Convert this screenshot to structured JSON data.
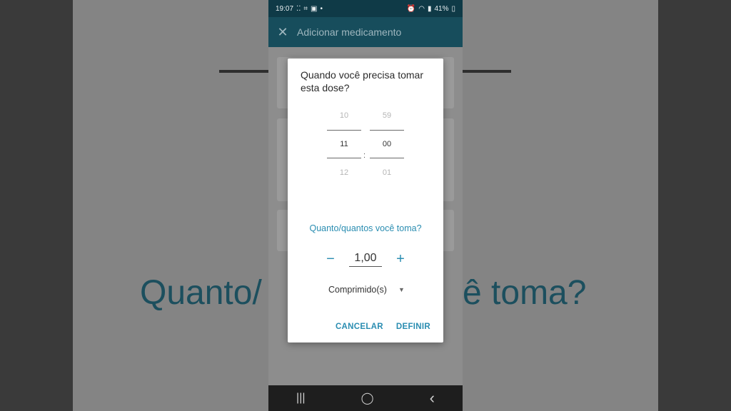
{
  "status_bar": {
    "time": "19:07",
    "battery": "41%",
    "left_icons": [
      "grid-icon",
      "screenshot-icon",
      "gallery-icon",
      "dot-icon"
    ],
    "right_icons": [
      "alarm-icon",
      "wifi-icon",
      "volte-icon",
      "signal-icon",
      "battery-icon"
    ]
  },
  "app_bar": {
    "close_icon": "close-icon",
    "title": "Adicionar medicamento"
  },
  "background": {
    "left_text": "Quanto/",
    "right_text": "ê toma?"
  },
  "dialog": {
    "title": "Quando você precisa tomar esta dose?",
    "time_picker": {
      "hours": {
        "prev": "10",
        "selected": "11",
        "next": "12"
      },
      "separator": ":",
      "minutes": {
        "prev": "59",
        "selected": "00",
        "next": "01"
      }
    },
    "quantity_label": "Quanto/quantos você toma?",
    "quantity": {
      "decrement_symbol": "−",
      "value": "1,00",
      "increment_symbol": "+"
    },
    "unit": {
      "selected": "Comprimido(s)"
    },
    "cancel_label": "CANCELAR",
    "confirm_label": "DEFINIR"
  },
  "nav_bar": {
    "recent_icon": "recent-apps-icon",
    "home_icon": "home-icon",
    "back_icon": "back-icon",
    "recent_glyph": "|||",
    "home_glyph": "◯",
    "back_glyph": "‹"
  },
  "colors": {
    "accent": "#2a8db1",
    "app_bar": "#174d5c",
    "status_bar": "#0f3a47"
  }
}
